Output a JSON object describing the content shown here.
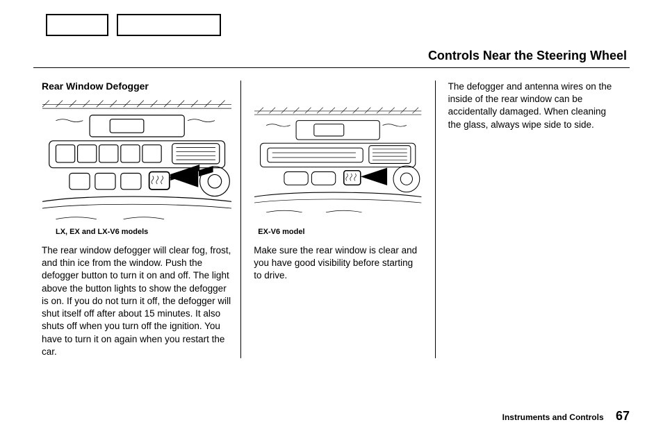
{
  "header": {
    "page_title": "Controls Near the Steering Wheel"
  },
  "col1": {
    "heading": "Rear Window Defogger",
    "figure_caption": "LX, EX and LX-V6 models",
    "body": "The rear window defogger will clear fog, frost, and thin ice from the window. Push the defogger button to turn it on and off. The light above the button lights to show the defogger is on. If you do not turn it off, the defogger will shut itself off after about 15 minutes. It also shuts off when you turn off the ignition. You have to turn it on again when you restart the car."
  },
  "col2": {
    "figure_caption": "EX-V6  model",
    "body": "Make sure the rear window is clear and you have good visibility before starting to drive."
  },
  "col3": {
    "body": "The defogger and antenna wires on the inside of the rear window can be accidentally damaged. When cleaning the glass, always wipe side to side."
  },
  "footer": {
    "section": "Instruments and Controls",
    "page_number": "67"
  }
}
